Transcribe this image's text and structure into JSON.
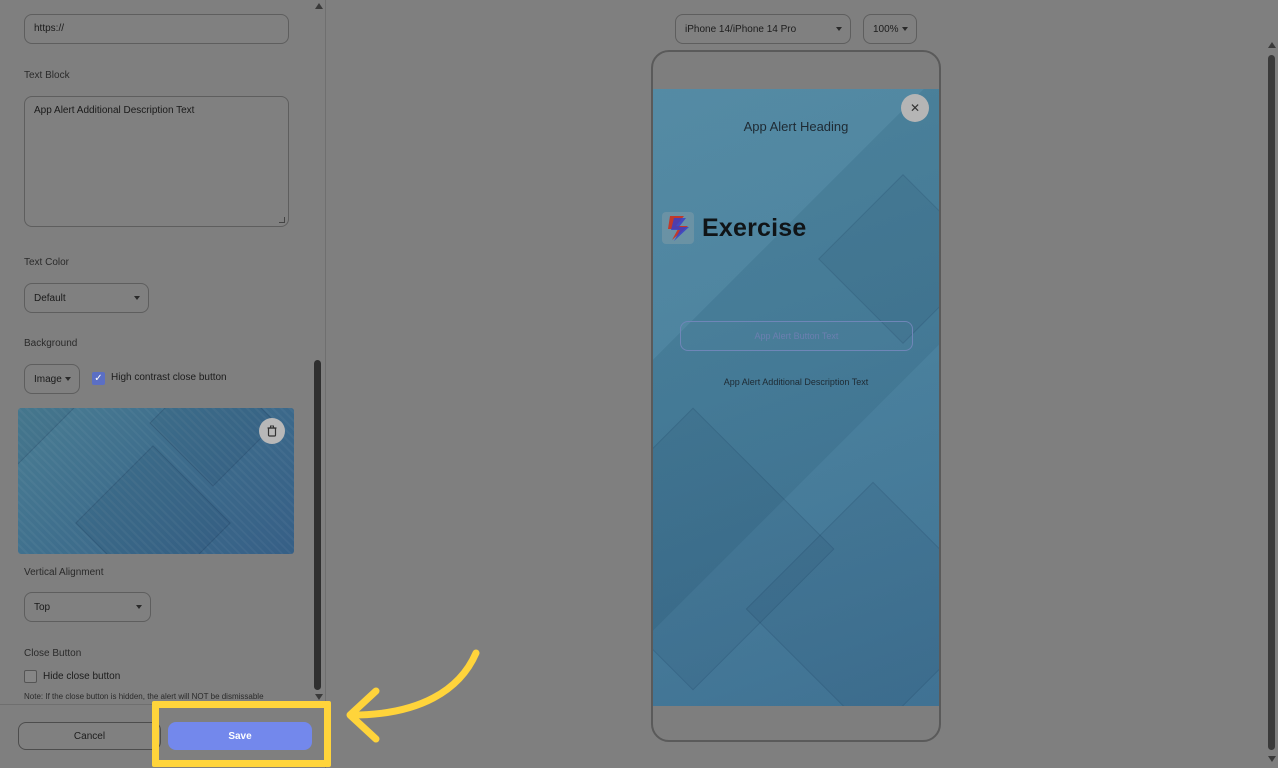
{
  "form": {
    "url_value": "https://",
    "text_block_label": "Text Block",
    "text_block_value": "App Alert Additional Description Text",
    "text_color_label": "Text Color",
    "text_color_value": "Default",
    "background_label": "Background",
    "background_value": "Image",
    "high_contrast_label": "High contrast close button",
    "high_contrast_checked": true,
    "delete_icon": "trash-icon",
    "vertical_alignment_label": "Vertical Alignment",
    "vertical_alignment_value": "Top",
    "close_button_label": "Close Button",
    "hide_close_label": "Hide close button",
    "hide_close_checked": false,
    "note": "Note: If the close button is hidden, the alert will NOT be dismissable"
  },
  "footer": {
    "cancel_label": "Cancel",
    "save_label": "Save",
    "highlight_color": "#ffd43b",
    "save_color": "#7388ec"
  },
  "preview": {
    "device_value": "iPhone 14/iPhone 14 Pro",
    "zoom_value": "100%",
    "alert": {
      "heading": "App Alert Heading",
      "logo_text": "Exercise",
      "button_text": "App Alert Button Text",
      "description": "App Alert Additional Description Text",
      "close_icon": "close-icon"
    }
  }
}
